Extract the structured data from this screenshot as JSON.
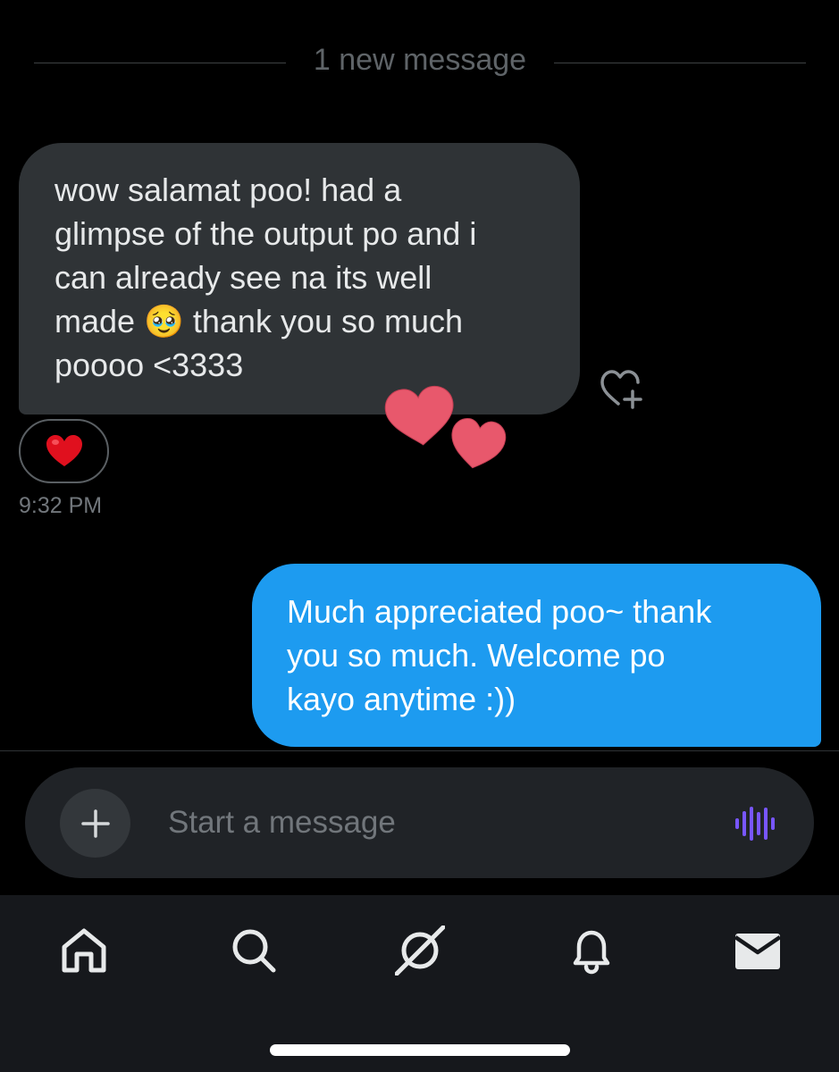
{
  "divider": {
    "label": "1 new message"
  },
  "incoming": {
    "text": "wow salamat poo! had a\nglimpse of the output po and i\ncan already see na its well\nmade 🥹 thank you so much\npoooo <3333",
    "reaction": "❤️",
    "time": "9:32 PM"
  },
  "outgoing": {
    "text": "Much appreciated poo~ thank\nyou so much. Welcome po\nkayo anytime :))"
  },
  "composer": {
    "placeholder": "Start a message",
    "add_icon": "plus-icon",
    "voice_icon": "voice-waveform-icon"
  },
  "nav": {
    "items": [
      {
        "name": "home",
        "icon": "home-icon"
      },
      {
        "name": "search",
        "icon": "search-icon"
      },
      {
        "name": "grok",
        "icon": "grok-icon"
      },
      {
        "name": "notifications",
        "icon": "bell-icon"
      },
      {
        "name": "messages",
        "icon": "mail-icon"
      }
    ]
  },
  "colors": {
    "background": "#000000",
    "incoming_bubble": "#2f3336",
    "outgoing_bubble": "#1d9bf0",
    "voice_accent": "#7856ff",
    "sticker_heart": "#e8586c"
  }
}
